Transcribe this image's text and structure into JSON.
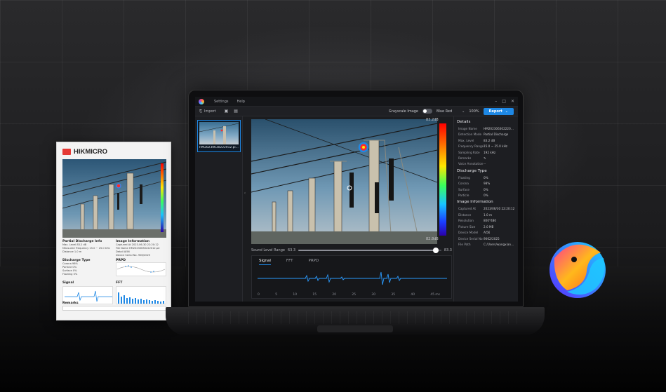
{
  "app": {
    "menu": [
      "Settings",
      "Help"
    ],
    "window_controls": [
      "–",
      "□",
      "✕"
    ],
    "toolbar": {
      "import_label": "Import",
      "grayscale_label": "Grayscale Image",
      "palette_value": "Blue Red",
      "zoom_value": "100%",
      "report_label": "Report"
    },
    "thumbnail": {
      "label": "HM20230630222012.pi..."
    },
    "scale": {
      "max": "83.2dB",
      "min": "82.8dB"
    },
    "sound_level": {
      "label": "Sound Level Range",
      "left_value": "63.3",
      "right_value": "83.3",
      "level_fraction": 0.96
    },
    "signal_tabs": [
      "Signal",
      "FFT",
      "PRPD"
    ],
    "signal_ticks": [
      "0",
      "5",
      "10",
      "15",
      "20",
      "25",
      "30",
      "35",
      "40",
      "45 ms"
    ],
    "details": {
      "title": "Details",
      "rows": [
        {
          "k": "Image Name",
          "v": "HM20230630222012.pd_1"
        },
        {
          "k": "Detection Mode",
          "v": "Partial Discharge"
        },
        {
          "k": "Max. Level",
          "v": "83.2 dB"
        },
        {
          "k": "Frequency Range",
          "v": "15.0 ~ 25.0 kHz"
        },
        {
          "k": "Sampling Rate",
          "v": "192 kHz"
        },
        {
          "k": "Remarks",
          "v": "✎"
        },
        {
          "k": "Voice Annotation",
          "v": "--"
        }
      ],
      "discharge_title": "Discharge Type",
      "discharge_rows": [
        {
          "k": "Floating",
          "v": "0%"
        },
        {
          "k": "Corona",
          "v": "98%"
        },
        {
          "k": "Surface",
          "v": "0%"
        },
        {
          "k": "Particle",
          "v": "0%"
        }
      ],
      "info_title": "Image Information",
      "info_rows": [
        {
          "k": "Captured At",
          "v": "2023/06/30 22:20:12"
        },
        {
          "k": "Distance",
          "v": "1.0 m"
        },
        {
          "k": "Resolution",
          "v": "800*480"
        },
        {
          "k": "Picture Size",
          "v": "2.0 MB"
        },
        {
          "k": "Device Model",
          "v": "AI56"
        },
        {
          "k": "Device Serial No.",
          "v": "9062/2025"
        },
        {
          "k": "File Path",
          "v": "C:/Users/wangxiangyu12/De..."
        }
      ]
    }
  },
  "report": {
    "brand": "HIKMICRO",
    "pd_title": "Partial Discharge Info",
    "pd_lines": [
      "Max. Level                83.2 dB",
      "Measured Frequency   15.0 ~ 25.0 kHz",
      "Distance                   1.0 m"
    ],
    "img_title": "Image Information",
    "img_lines": [
      "Captured At         2023-06-30 22:20:12",
      "File Name           HM20230630222012.pd",
      "Detail              AI56",
      "Device Serial No.   906/2025"
    ],
    "dt_title": "Discharge Type",
    "dt_lines": [
      "Corona          98%",
      "Particle          0%",
      "Surface          0%",
      "Floating         0%"
    ],
    "prpd_title": "PRPD",
    "signal_title": "Signal",
    "fft_title": "FFT",
    "remarks_title": "Remarks"
  }
}
